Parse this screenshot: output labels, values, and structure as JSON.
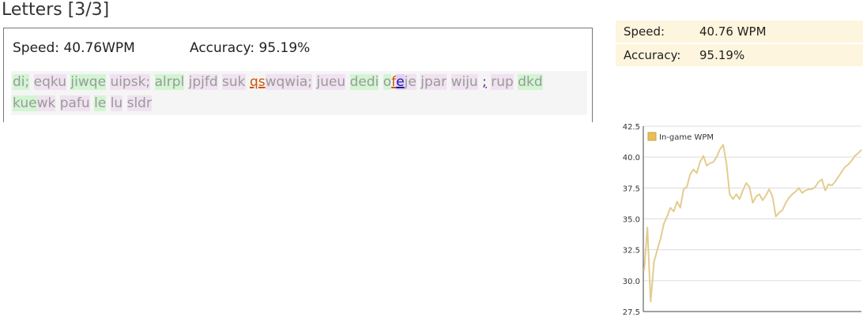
{
  "page": {
    "title": "Letters [3/3]"
  },
  "result_panel": {
    "speed_label": "Speed:",
    "speed_value": "40.76WPM",
    "accuracy_label": "Accuracy:",
    "accuracy_value": "95.19%",
    "text_segments": [
      {
        "text": "di;",
        "status": "ok"
      },
      {
        "text": " ",
        "status": "plain"
      },
      {
        "text": "eqku",
        "status": "slow"
      },
      {
        "text": " ",
        "status": "plain"
      },
      {
        "text": "jiwqe",
        "status": "ok"
      },
      {
        "text": " ",
        "status": "plain"
      },
      {
        "text": "uipsk;",
        "status": "slow"
      },
      {
        "text": " ",
        "status": "plain"
      },
      {
        "text": "alrpl",
        "status": "ok"
      },
      {
        "text": " ",
        "status": "plain"
      },
      {
        "text": "jpjfd",
        "status": "slow"
      },
      {
        "text": " ",
        "status": "plain"
      },
      {
        "text": "suk",
        "status": "slow"
      },
      {
        "text": " ",
        "status": "plain"
      },
      {
        "text": "qs",
        "status": "err"
      },
      {
        "text": "wqwia;",
        "status": "slow"
      },
      {
        "text": " ",
        "status": "plain"
      },
      {
        "text": "jueu",
        "status": "slow"
      },
      {
        "text": " ",
        "status": "plain"
      },
      {
        "text": "dedi",
        "status": "ok"
      },
      {
        "text": " ",
        "status": "plain"
      },
      {
        "text": "o",
        "status": "ok"
      },
      {
        "text": "f",
        "status": "err"
      },
      {
        "text": "e",
        "status": "cursor"
      },
      {
        "text": "je",
        "status": "slow"
      },
      {
        "text": " ",
        "status": "plain"
      },
      {
        "text": "jpar",
        "status": "slow"
      },
      {
        "text": " ",
        "status": "plain"
      },
      {
        "text": "wiju",
        "status": "slow"
      },
      {
        "text": " ",
        "status": "plain"
      },
      {
        "text": ";",
        "status": "err_alt"
      },
      {
        "text": " ",
        "status": "plain"
      },
      {
        "text": "rup",
        "status": "slow"
      },
      {
        "text": " ",
        "status": "plain"
      },
      {
        "text": "dkd",
        "status": "ok"
      },
      {
        "text": " ",
        "status": "plain"
      },
      {
        "text": "kue",
        "status": "ok"
      },
      {
        "text": "wk",
        "status": "slow"
      },
      {
        "text": " ",
        "status": "plain"
      },
      {
        "text": "pafu",
        "status": "slow"
      },
      {
        "text": " ",
        "status": "plain"
      },
      {
        "text": "le",
        "status": "ok"
      },
      {
        "text": " ",
        "status": "plain"
      },
      {
        "text": "lu",
        "status": "slow"
      },
      {
        "text": " ",
        "status": "plain"
      },
      {
        "text": "sldr",
        "status": "slow"
      }
    ]
  },
  "summary": {
    "rows": [
      {
        "key": "Speed:",
        "value": "40.76 WPM"
      },
      {
        "key": "Accuracy:",
        "value": "95.19%"
      }
    ]
  },
  "colors": {
    "ok_bg": "#d2f5d2",
    "slow_bg": "#f0e2f0",
    "error_text": "#cc5500",
    "line": "#e3cc8f",
    "legend_swatch": "#e6bf5a",
    "summary_bg": "#fdf5dd"
  },
  "chart_data": {
    "type": "line",
    "title": "",
    "xlabel": "",
    "ylabel": "",
    "legend": "top-left",
    "grid": true,
    "ylim": [
      27.5,
      42.5
    ],
    "yticks": [
      "42.5",
      "40.0",
      "37.5",
      "35.0",
      "32.5",
      "30.0",
      "27.5"
    ],
    "series": [
      {
        "name": "In-game WPM",
        "values": [
          30.8,
          34.3,
          28.3,
          31.5,
          32.5,
          33.4,
          34.6,
          35.2,
          35.9,
          35.6,
          36.4,
          35.9,
          37.4,
          37.6,
          38.6,
          39.0,
          38.7,
          39.6,
          40.1,
          39.3,
          39.5,
          39.6,
          40.0,
          40.6,
          41.0,
          39.5,
          37.0,
          36.6,
          37.0,
          36.6,
          37.3,
          37.9,
          37.6,
          36.3,
          36.8,
          37.0,
          36.5,
          36.9,
          37.4,
          36.8,
          35.2,
          35.5,
          35.7,
          36.3,
          36.7,
          37.0,
          37.2,
          37.5,
          37.1,
          37.3,
          37.4,
          37.4,
          37.6,
          38.0,
          38.2,
          37.3,
          37.8,
          37.7,
          38.0,
          38.4,
          38.8,
          39.2,
          39.4,
          39.7,
          40.1,
          40.3,
          40.6
        ]
      }
    ]
  }
}
